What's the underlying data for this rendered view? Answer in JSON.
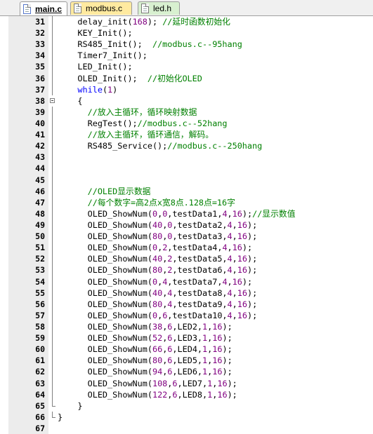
{
  "tabs": [
    {
      "label": "main.c",
      "active": true,
      "color": "#ffffff"
    },
    {
      "label": "modbus.c",
      "active": false,
      "color": "#ffeaa0"
    },
    {
      "label": "led.h",
      "active": false,
      "color": "#d8f0d0"
    }
  ],
  "colors": {
    "keyword": "#0000ff",
    "number": "#800080",
    "comment": "#008000",
    "gutter": "#ececec"
  },
  "lines": [
    {
      "n": "31",
      "fold": "mid",
      "indent": 1,
      "tokens": [
        [
          "pl",
          "delay_init("
        ],
        [
          "num",
          "168"
        ],
        [
          "pl",
          "); "
        ],
        [
          "cm",
          "//延时函数初始化"
        ]
      ]
    },
    {
      "n": "32",
      "fold": "mid",
      "indent": 1,
      "tokens": [
        [
          "pl",
          "KEY_Init();"
        ]
      ]
    },
    {
      "n": "33",
      "fold": "mid",
      "indent": 1,
      "tokens": [
        [
          "pl",
          "RS485_Init();  "
        ],
        [
          "cm",
          "//modbus.c--95hang"
        ]
      ]
    },
    {
      "n": "34",
      "fold": "mid",
      "indent": 1,
      "tokens": [
        [
          "pl",
          "Timer7_Init();"
        ]
      ]
    },
    {
      "n": "35",
      "fold": "mid",
      "indent": 1,
      "tokens": [
        [
          "pl",
          "LED_Init();"
        ]
      ]
    },
    {
      "n": "36",
      "fold": "mid",
      "indent": 1,
      "tokens": [
        [
          "pl",
          "OLED_Init();  "
        ],
        [
          "cm",
          "//初始化OLED"
        ]
      ]
    },
    {
      "n": "37",
      "fold": "mid",
      "indent": 1,
      "tokens": [
        [
          "kw",
          "while"
        ],
        [
          "pl",
          "("
        ],
        [
          "num",
          "1"
        ],
        [
          "pl",
          ")"
        ]
      ]
    },
    {
      "n": "38",
      "fold": "start",
      "indent": 1,
      "tokens": [
        [
          "pl",
          "{"
        ]
      ]
    },
    {
      "n": "39",
      "fold": "mid",
      "indent": 2,
      "tokens": [
        [
          "cm",
          "//放入主循环，循环映射数据"
        ]
      ]
    },
    {
      "n": "40",
      "fold": "mid",
      "indent": 2,
      "tokens": [
        [
          "pl",
          "RegTest();"
        ],
        [
          "cm",
          "//modbus.c--52hang"
        ]
      ]
    },
    {
      "n": "41",
      "fold": "mid",
      "indent": 2,
      "tokens": [
        [
          "cm",
          "//放入主循环，循环通信，解码。"
        ]
      ]
    },
    {
      "n": "42",
      "fold": "mid",
      "indent": 2,
      "tokens": [
        [
          "pl",
          "RS485_Service();"
        ],
        [
          "cm",
          "//modbus.c--250hang"
        ]
      ]
    },
    {
      "n": "43",
      "fold": "mid",
      "indent": 2,
      "tokens": []
    },
    {
      "n": "44",
      "fold": "mid",
      "indent": 2,
      "tokens": []
    },
    {
      "n": "45",
      "fold": "mid",
      "indent": 2,
      "tokens": []
    },
    {
      "n": "46",
      "fold": "mid",
      "indent": 2,
      "tokens": [
        [
          "cm",
          "//OLED显示数据"
        ]
      ]
    },
    {
      "n": "47",
      "fold": "mid",
      "indent": 2,
      "tokens": [
        [
          "cm",
          "//每个数字=高2点x宽8点.128点=16字"
        ]
      ]
    },
    {
      "n": "48",
      "fold": "mid",
      "indent": 2,
      "tokens": [
        [
          "pl",
          "OLED_ShowNum("
        ],
        [
          "num",
          "0"
        ],
        [
          "pl",
          ","
        ],
        [
          "num",
          "0"
        ],
        [
          "pl",
          ",testData1,"
        ],
        [
          "num",
          "4"
        ],
        [
          "pl",
          ","
        ],
        [
          "num",
          "16"
        ],
        [
          "pl",
          ");"
        ],
        [
          "cm",
          "//显示数值"
        ]
      ]
    },
    {
      "n": "49",
      "fold": "mid",
      "indent": 2,
      "tokens": [
        [
          "pl",
          "OLED_ShowNum("
        ],
        [
          "num",
          "40"
        ],
        [
          "pl",
          ","
        ],
        [
          "num",
          "0"
        ],
        [
          "pl",
          ",testData2,"
        ],
        [
          "num",
          "4"
        ],
        [
          "pl",
          ","
        ],
        [
          "num",
          "16"
        ],
        [
          "pl",
          ");"
        ]
      ]
    },
    {
      "n": "50",
      "fold": "mid",
      "indent": 2,
      "tokens": [
        [
          "pl",
          "OLED_ShowNum("
        ],
        [
          "num",
          "80"
        ],
        [
          "pl",
          ","
        ],
        [
          "num",
          "0"
        ],
        [
          "pl",
          ",testData3,"
        ],
        [
          "num",
          "4"
        ],
        [
          "pl",
          ","
        ],
        [
          "num",
          "16"
        ],
        [
          "pl",
          ");"
        ]
      ]
    },
    {
      "n": "51",
      "fold": "mid",
      "indent": 2,
      "tokens": [
        [
          "pl",
          "OLED_ShowNum("
        ],
        [
          "num",
          "0"
        ],
        [
          "pl",
          ","
        ],
        [
          "num",
          "2"
        ],
        [
          "pl",
          ",testData4,"
        ],
        [
          "num",
          "4"
        ],
        [
          "pl",
          ","
        ],
        [
          "num",
          "16"
        ],
        [
          "pl",
          ");"
        ]
      ]
    },
    {
      "n": "52",
      "fold": "mid",
      "indent": 2,
      "tokens": [
        [
          "pl",
          "OLED_ShowNum("
        ],
        [
          "num",
          "40"
        ],
        [
          "pl",
          ","
        ],
        [
          "num",
          "2"
        ],
        [
          "pl",
          ",testData5,"
        ],
        [
          "num",
          "4"
        ],
        [
          "pl",
          ","
        ],
        [
          "num",
          "16"
        ],
        [
          "pl",
          ");"
        ]
      ]
    },
    {
      "n": "53",
      "fold": "mid",
      "indent": 2,
      "tokens": [
        [
          "pl",
          "OLED_ShowNum("
        ],
        [
          "num",
          "80"
        ],
        [
          "pl",
          ","
        ],
        [
          "num",
          "2"
        ],
        [
          "pl",
          ",testData6,"
        ],
        [
          "num",
          "4"
        ],
        [
          "pl",
          ","
        ],
        [
          "num",
          "16"
        ],
        [
          "pl",
          ");"
        ]
      ]
    },
    {
      "n": "54",
      "fold": "mid",
      "indent": 2,
      "tokens": [
        [
          "pl",
          "OLED_ShowNum("
        ],
        [
          "num",
          "0"
        ],
        [
          "pl",
          ","
        ],
        [
          "num",
          "4"
        ],
        [
          "pl",
          ",testData7,"
        ],
        [
          "num",
          "4"
        ],
        [
          "pl",
          ","
        ],
        [
          "num",
          "16"
        ],
        [
          "pl",
          ");"
        ]
      ]
    },
    {
      "n": "55",
      "fold": "mid",
      "indent": 2,
      "tokens": [
        [
          "pl",
          "OLED_ShowNum("
        ],
        [
          "num",
          "40"
        ],
        [
          "pl",
          ","
        ],
        [
          "num",
          "4"
        ],
        [
          "pl",
          ",testData8,"
        ],
        [
          "num",
          "4"
        ],
        [
          "pl",
          ","
        ],
        [
          "num",
          "16"
        ],
        [
          "pl",
          ");"
        ]
      ]
    },
    {
      "n": "56",
      "fold": "mid",
      "indent": 2,
      "tokens": [
        [
          "pl",
          "OLED_ShowNum("
        ],
        [
          "num",
          "80"
        ],
        [
          "pl",
          ","
        ],
        [
          "num",
          "4"
        ],
        [
          "pl",
          ",testData9,"
        ],
        [
          "num",
          "4"
        ],
        [
          "pl",
          ","
        ],
        [
          "num",
          "16"
        ],
        [
          "pl",
          ");"
        ]
      ]
    },
    {
      "n": "57",
      "fold": "mid",
      "indent": 2,
      "tokens": [
        [
          "pl",
          "OLED_ShowNum("
        ],
        [
          "num",
          "0"
        ],
        [
          "pl",
          ","
        ],
        [
          "num",
          "6"
        ],
        [
          "pl",
          ",testData10,"
        ],
        [
          "num",
          "4"
        ],
        [
          "pl",
          ","
        ],
        [
          "num",
          "16"
        ],
        [
          "pl",
          ");"
        ]
      ]
    },
    {
      "n": "58",
      "fold": "mid",
      "indent": 2,
      "tokens": [
        [
          "pl",
          "OLED_ShowNum("
        ],
        [
          "num",
          "38"
        ],
        [
          "pl",
          ","
        ],
        [
          "num",
          "6"
        ],
        [
          "pl",
          ",LED2,"
        ],
        [
          "num",
          "1"
        ],
        [
          "pl",
          ","
        ],
        [
          "num",
          "16"
        ],
        [
          "pl",
          ");"
        ]
      ]
    },
    {
      "n": "59",
      "fold": "mid",
      "indent": 2,
      "tokens": [
        [
          "pl",
          "OLED_ShowNum("
        ],
        [
          "num",
          "52"
        ],
        [
          "pl",
          ","
        ],
        [
          "num",
          "6"
        ],
        [
          "pl",
          ",LED3,"
        ],
        [
          "num",
          "1"
        ],
        [
          "pl",
          ","
        ],
        [
          "num",
          "16"
        ],
        [
          "pl",
          ");"
        ]
      ]
    },
    {
      "n": "60",
      "fold": "mid",
      "indent": 2,
      "tokens": [
        [
          "pl",
          "OLED_ShowNum("
        ],
        [
          "num",
          "66"
        ],
        [
          "pl",
          ","
        ],
        [
          "num",
          "6"
        ],
        [
          "pl",
          ",LED4,"
        ],
        [
          "num",
          "1"
        ],
        [
          "pl",
          ","
        ],
        [
          "num",
          "16"
        ],
        [
          "pl",
          ");"
        ]
      ]
    },
    {
      "n": "61",
      "fold": "mid",
      "indent": 2,
      "tokens": [
        [
          "pl",
          "OLED_ShowNum("
        ],
        [
          "num",
          "80"
        ],
        [
          "pl",
          ","
        ],
        [
          "num",
          "6"
        ],
        [
          "pl",
          ",LED5,"
        ],
        [
          "num",
          "1"
        ],
        [
          "pl",
          ","
        ],
        [
          "num",
          "16"
        ],
        [
          "pl",
          ");"
        ]
      ]
    },
    {
      "n": "62",
      "fold": "mid",
      "indent": 2,
      "tokens": [
        [
          "pl",
          "OLED_ShowNum("
        ],
        [
          "num",
          "94"
        ],
        [
          "pl",
          ","
        ],
        [
          "num",
          "6"
        ],
        [
          "pl",
          ",LED6,"
        ],
        [
          "num",
          "1"
        ],
        [
          "pl",
          ","
        ],
        [
          "num",
          "16"
        ],
        [
          "pl",
          ");"
        ]
      ]
    },
    {
      "n": "63",
      "fold": "mid",
      "indent": 2,
      "tokens": [
        [
          "pl",
          "OLED_ShowNum("
        ],
        [
          "num",
          "108"
        ],
        [
          "pl",
          ","
        ],
        [
          "num",
          "6"
        ],
        [
          "pl",
          ",LED7,"
        ],
        [
          "num",
          "1"
        ],
        [
          "pl",
          ","
        ],
        [
          "num",
          "16"
        ],
        [
          "pl",
          ");"
        ]
      ]
    },
    {
      "n": "64",
      "fold": "mid",
      "indent": 2,
      "tokens": [
        [
          "pl",
          "OLED_ShowNum("
        ],
        [
          "num",
          "122"
        ],
        [
          "pl",
          ","
        ],
        [
          "num",
          "6"
        ],
        [
          "pl",
          ",LED8,"
        ],
        [
          "num",
          "1"
        ],
        [
          "pl",
          ","
        ],
        [
          "num",
          "16"
        ],
        [
          "pl",
          ");"
        ]
      ]
    },
    {
      "n": "65",
      "fold": "end",
      "indent": 1,
      "tokens": [
        [
          "pl",
          "}"
        ]
      ]
    },
    {
      "n": "66",
      "fold": "end",
      "indent": 0,
      "tokens": [
        [
          "pl",
          "}"
        ]
      ]
    },
    {
      "n": "67",
      "fold": "",
      "indent": 0,
      "tokens": []
    }
  ]
}
